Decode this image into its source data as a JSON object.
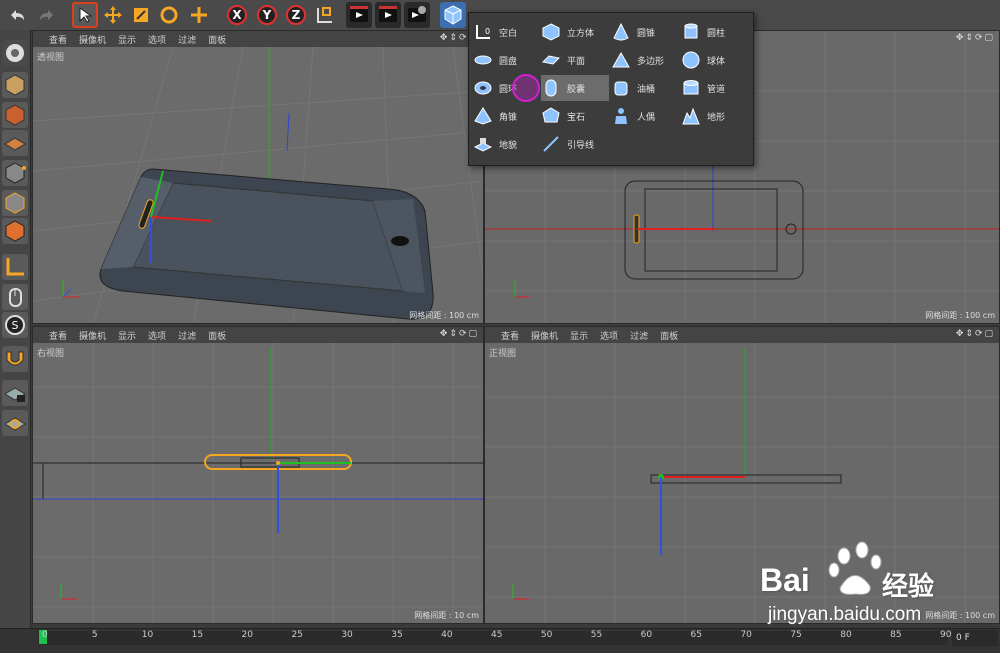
{
  "viewport_menu": [
    "查看",
    "摄像机",
    "显示",
    "选项",
    "过滤",
    "面板"
  ],
  "viewports": {
    "perspective": {
      "name": "透视图",
      "grid": "网格间距 : 100 cm"
    },
    "top": {
      "name": "",
      "grid": "网格间距 : 100 cm"
    },
    "right": {
      "name": "右视图",
      "grid": "网格间距 : 10 cm"
    },
    "front": {
      "name": "正视图",
      "grid": "网格间距 : 100 cm"
    }
  },
  "toolbar": {
    "axis_x": "X",
    "axis_y": "Y",
    "axis_z": "Z"
  },
  "popup_items": [
    {
      "label": "空白",
      "icon": "null-icon"
    },
    {
      "label": "立方体",
      "icon": "cube-icon"
    },
    {
      "label": "圆锥",
      "icon": "cone-icon"
    },
    {
      "label": "圆柱",
      "icon": "cylinder-icon"
    },
    {
      "label": "圆盘",
      "icon": "disc-icon"
    },
    {
      "label": "平面",
      "icon": "plane-icon"
    },
    {
      "label": "多边形",
      "icon": "polygon-icon"
    },
    {
      "label": "球体",
      "icon": "sphere-icon"
    },
    {
      "label": "圆环",
      "icon": "torus-icon"
    },
    {
      "label": "胶囊",
      "icon": "capsule-icon"
    },
    {
      "label": "油桶",
      "icon": "oil-tank-icon"
    },
    {
      "label": "管道",
      "icon": "tube-icon"
    },
    {
      "label": "角锥",
      "icon": "pyramid-icon"
    },
    {
      "label": "宝石",
      "icon": "platonic-icon"
    },
    {
      "label": "人偶",
      "icon": "figure-icon"
    },
    {
      "label": "地形",
      "icon": "landscape-icon"
    },
    {
      "label": "地貌",
      "icon": "relief-icon"
    },
    {
      "label": "引导线",
      "icon": "guide-icon"
    }
  ],
  "popup_active": "胶囊",
  "timeline": {
    "ticks": [
      "0",
      "5",
      "10",
      "15",
      "20",
      "25",
      "30",
      "35",
      "40",
      "45",
      "50",
      "55",
      "60",
      "65",
      "70",
      "75",
      "80",
      "85",
      "90"
    ],
    "frame_label": "0 F"
  },
  "watermark": {
    "brand": "Bai",
    "brand2": "经验",
    "url": "jingyan.baidu.com"
  },
  "colors": {
    "accent_orange": "#f5a623",
    "axis_red": "#e02020",
    "axis_green": "#20c020",
    "axis_blue": "#3050e0",
    "highlight_magenta": "#d020d0"
  }
}
